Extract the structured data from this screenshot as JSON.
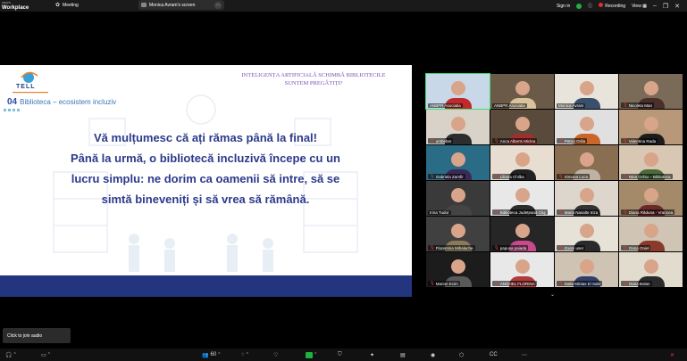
{
  "app": {
    "brand_top": "zoom",
    "brand_bottom": "Workplace",
    "meeting_label": "Meeting",
    "share_label": "Monica Avram's screen",
    "sign_in": "Sign in",
    "recording": "Recording",
    "view": "View"
  },
  "slide": {
    "header_title_line1": "INTELIGENȚA ARTIFICIALĂ SCHIMBĂ BIBLIOTECILE",
    "header_title_line2": "SUNTEM PREGĂTIȚI?",
    "logo_text": "TELL",
    "section_number": "04",
    "section_title": "Biblioteca – ecosistem incluziv",
    "body_lines": [
      "Vă mulțumesc că ați rămas până la final!",
      "Până la urmă, o bibliotecă incluzivă începe cu un",
      "lucru simplu: ne dorim ca oamenii să intre, să se",
      "simtă bineveniți și să vrea să rămână."
    ]
  },
  "participants": [
    {
      "name": "ANBPR Asociatia",
      "muted": false,
      "bg": "#c8d8e8",
      "shirt": "#c02a2a",
      "active": true
    },
    {
      "name": "ANBPR Asociatia",
      "muted": false,
      "bg": "#6b5a48",
      "shirt": "#d9c39c",
      "active": false
    },
    {
      "name": "Monica Avram",
      "muted": false,
      "bg": "#e8e4dc",
      "shirt": "#3a4f6c",
      "active": false
    },
    {
      "name": "Nicoleta Man",
      "muted": true,
      "bg": "#7a6a58",
      "shirt": "#4b2f2a",
      "active": false
    },
    {
      "name": "ursbeber",
      "muted": true,
      "bg": "#d8d2c8",
      "shirt": "#2d2d2d",
      "active": false
    },
    {
      "name": "Anca Alberts Miclea",
      "muted": true,
      "bg": "#5a4a3c",
      "shirt": "#a03030",
      "active": false
    },
    {
      "name": "Petruț Otilia",
      "muted": true,
      "bg": "#e0e0e0",
      "shirt": "#c9662a",
      "active": false
    },
    {
      "name": "Valentina Rada",
      "muted": true,
      "bg": "#b89878",
      "shirt": "#1c1c1c",
      "active": false
    },
    {
      "name": "Gabriela Zamfir",
      "muted": true,
      "bg": "#2a6b86",
      "shirt": "#3b2a55",
      "active": false
    },
    {
      "name": "Liliana Chilba",
      "muted": true,
      "bg": "#e7ddd1",
      "shirt": "#222222",
      "active": false
    },
    {
      "name": "Simona Luca",
      "muted": true,
      "bg": "#8a6e52",
      "shirt": "#bfb2a2",
      "active": false
    },
    {
      "name": "Nina Ochiu – Biblioteca",
      "muted": true,
      "bg": "#d7c7b3",
      "shirt": "#4a6a3a",
      "active": false
    },
    {
      "name": "Irina Tudor",
      "muted": false,
      "bg": "#3a3a3a",
      "shirt": "#444444",
      "active": false
    },
    {
      "name": "Biblioteca Județeană Cluj",
      "muted": true,
      "bg": "#e8e8e8",
      "shirt": "#2c2c2c",
      "active": false
    },
    {
      "name": "Maria Nasalte Iriza",
      "muted": true,
      "bg": "#dcd6cc",
      "shirt": "#333333",
      "active": false
    },
    {
      "name": "Diana Răduna - Vrancea",
      "muted": true,
      "bg": "#a58a6a",
      "shirt": "#6b2a2a",
      "active": false
    },
    {
      "name": "Florentina Mihalache",
      "muted": true,
      "bg": "#404040",
      "shirt": "#8a7a5a",
      "active": false
    },
    {
      "name": "papusa paiada",
      "muted": true,
      "bg": "#262626",
      "shirt": "#c74a8a",
      "active": false
    },
    {
      "name": "Zoom user",
      "muted": true,
      "bg": "#e6e2d8",
      "shirt": "#2a2a2a",
      "active": false
    },
    {
      "name": "Oana Oniel",
      "muted": true,
      "bg": "#d0c5b5",
      "shirt": "#8a3a2a",
      "active": false
    },
    {
      "name": "Marion Ecim",
      "muted": true,
      "bg": "#1c1c1c",
      "shirt": "#5a5a5a",
      "active": false
    },
    {
      "name": "ANGHEL FLORINA",
      "muted": true,
      "bg": "#e8e8e8",
      "shirt": "#b33a3a",
      "active": false
    },
    {
      "name": "Dalia Mintas El Sabi",
      "muted": true,
      "bg": "#cfc3b3",
      "shirt": "#2f3f6a",
      "active": false
    },
    {
      "name": "Oana Bolan",
      "muted": true,
      "bg": "#e2dccf",
      "shirt": "#2a2a2a",
      "active": false
    }
  ],
  "audio_toast": "Click to join audio",
  "toolbar": {
    "participants_count": "60"
  },
  "colors": {
    "slide_footer": "#24357f",
    "slide_text": "#2c3a8c",
    "active_speaker": "#3ddc6f",
    "recording": "#e02f2f"
  }
}
